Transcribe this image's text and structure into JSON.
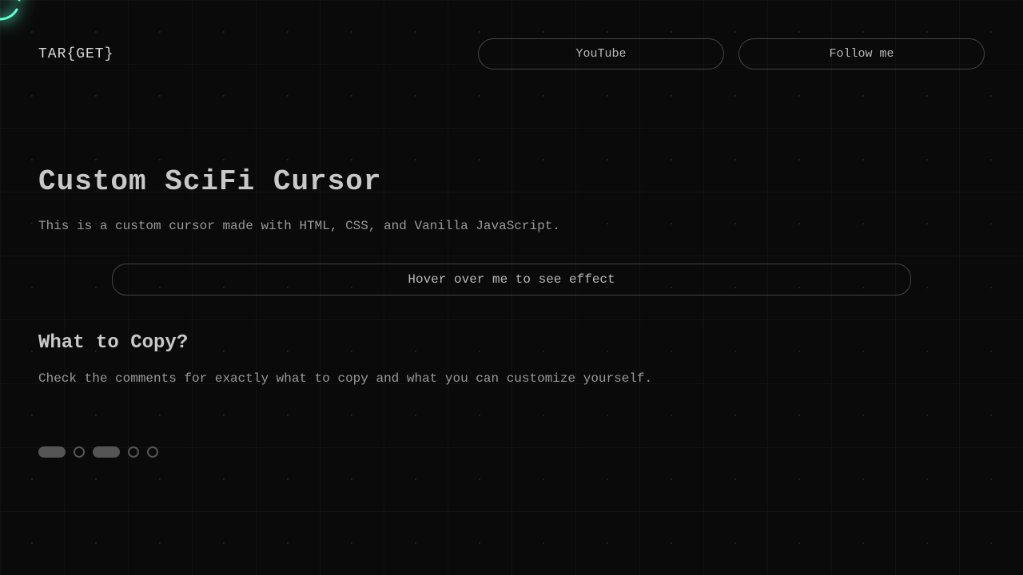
{
  "header": {
    "logo": "TAR{GET}",
    "buttons": {
      "youtube": "YouTube",
      "follow": "Follow me"
    }
  },
  "main": {
    "title": "Custom SciFi Cursor",
    "description": "This is a custom cursor made with HTML, CSS, and Vanilla JavaScript.",
    "hover_button": "Hover over me to see effect",
    "subtitle": "What to Copy?",
    "description2": "Check the comments for exactly what to copy and what you can customize yourself."
  },
  "colors": {
    "accent": "#5fffd0",
    "text": "#b8b8b8",
    "background": "#0a0a0a"
  }
}
